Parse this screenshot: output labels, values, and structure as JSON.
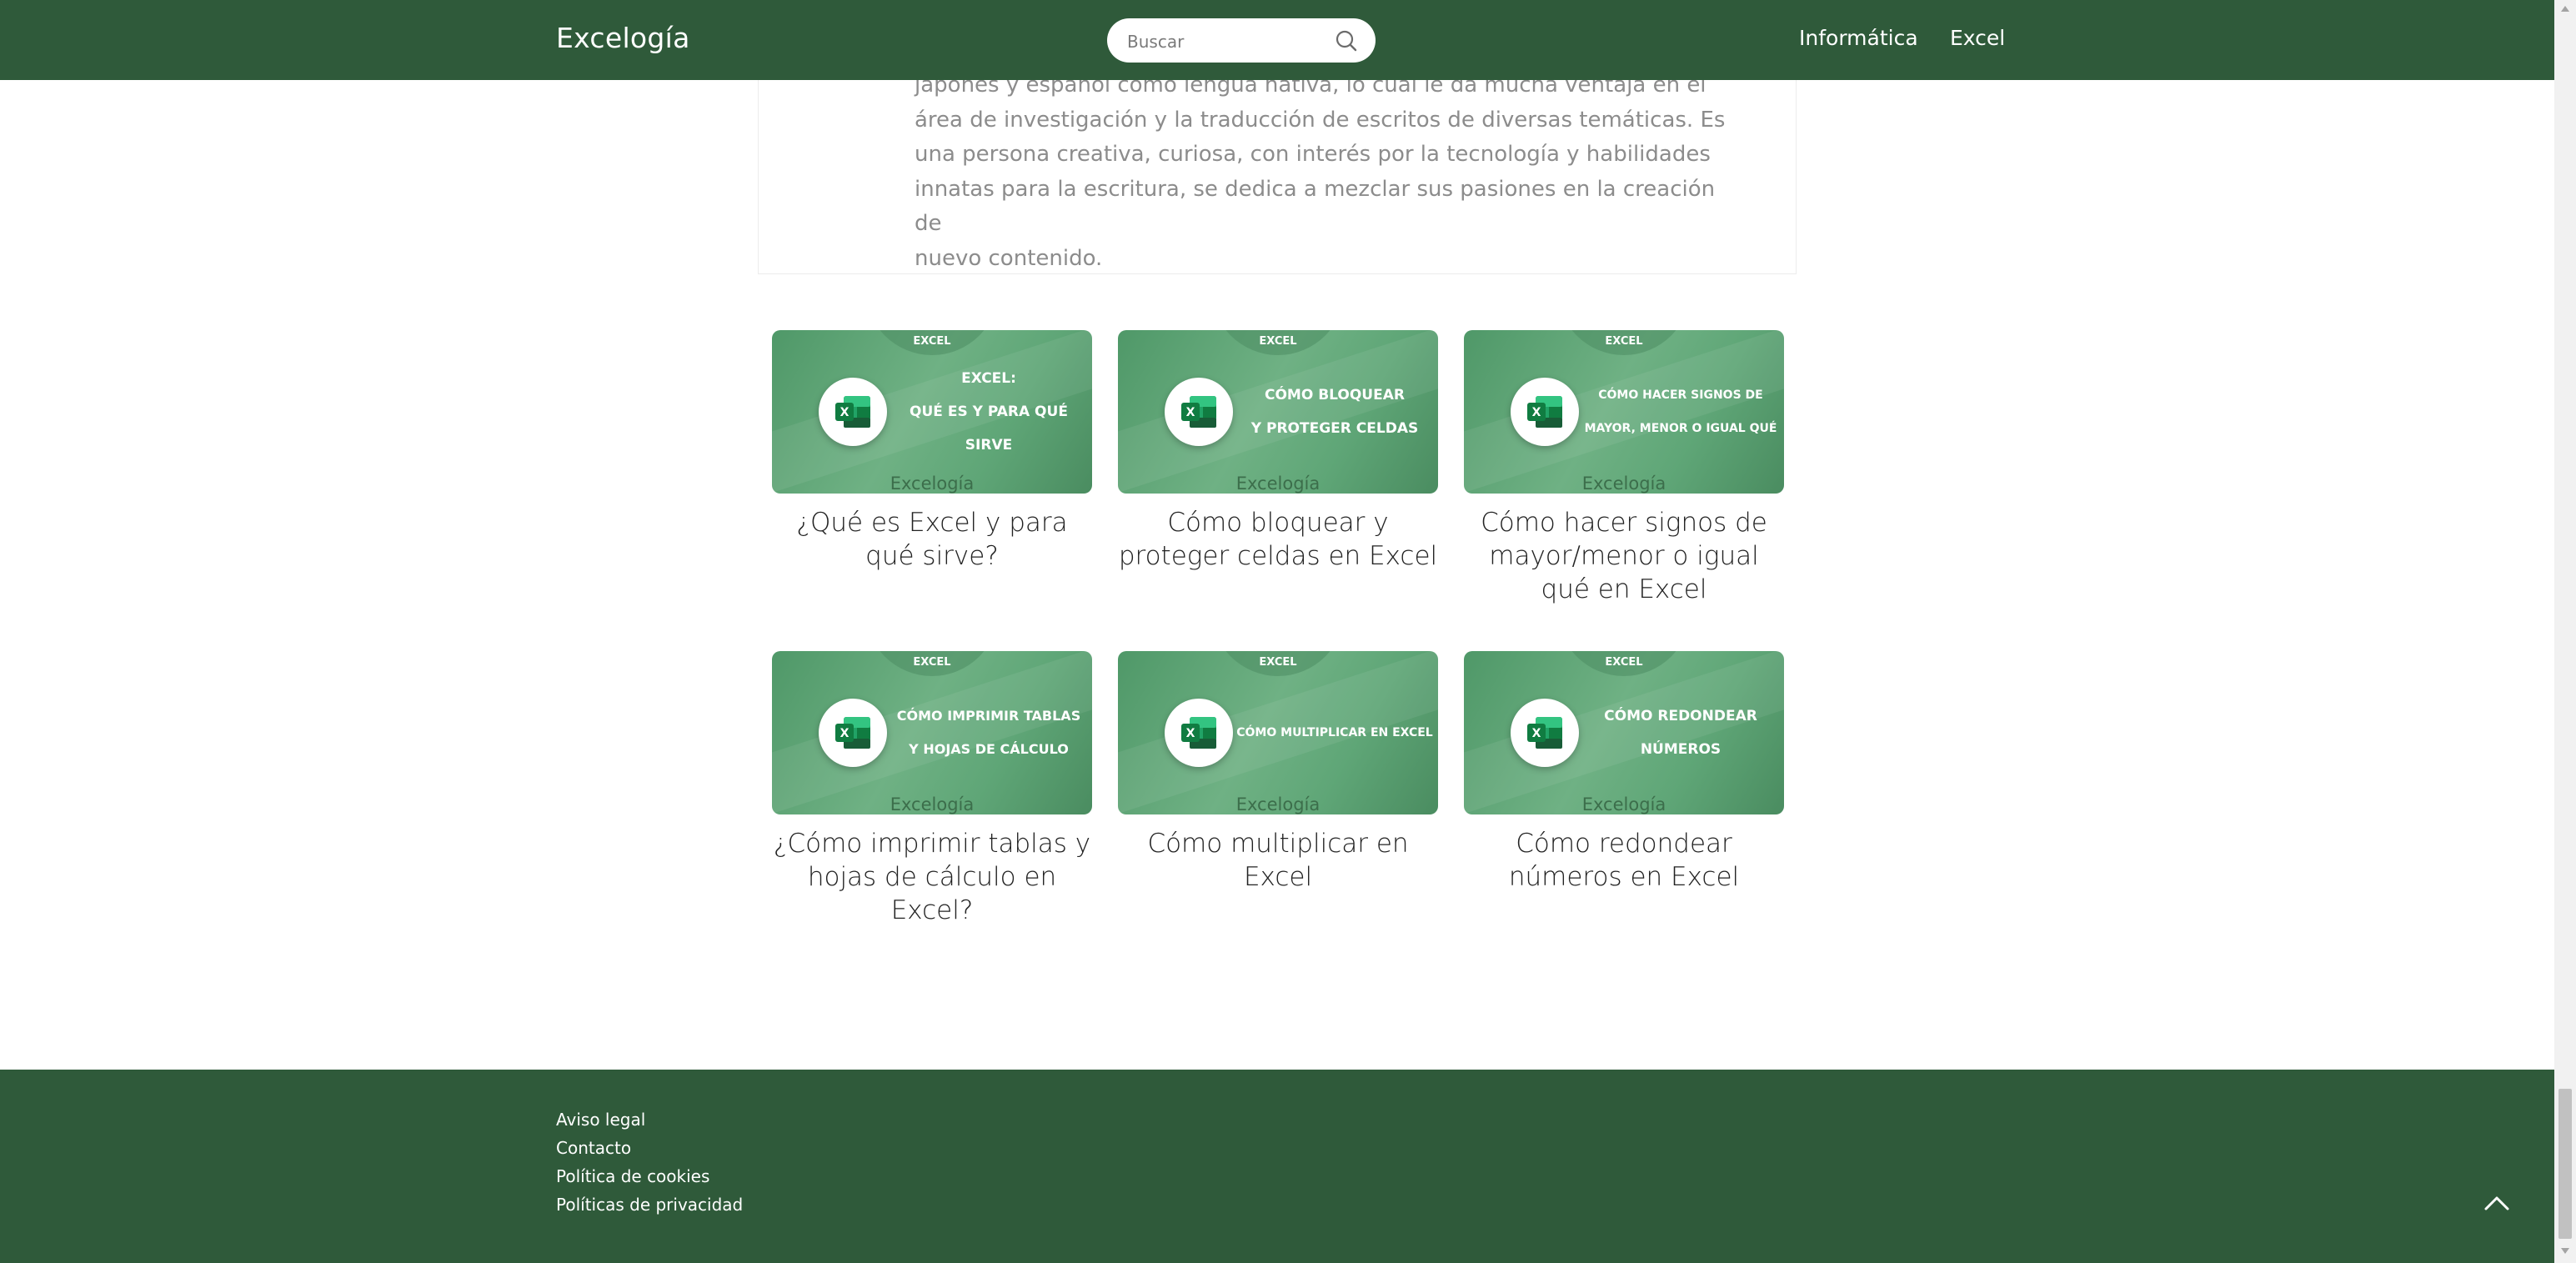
{
  "header": {
    "logo": "Excelogía",
    "search_placeholder": "Buscar",
    "nav": [
      "Informática",
      "Excel"
    ]
  },
  "author_bio": {
    "lines": [
      "japonés y español como lengua nativa, lo cual le da mucha ventaja en el",
      "área de investigación y la traducción de escritos de diversas temáticas. Es",
      "una persona creativa, curiosa, con interés por la tecnología y habilidades",
      "innatas para la escritura, se dedica a mezclar sus pasiones en la creación de",
      "nuevo contenido."
    ]
  },
  "related_posts": [
    {
      "thumb_category": "EXCEL",
      "thumb_title": "EXCEL:\nQUÉ ES Y PARA QUÉ SIRVE",
      "thumb_brand": "Excelogía",
      "title": "¿Qué es Excel y para qué sirve?"
    },
    {
      "thumb_category": "EXCEL",
      "thumb_title": "CÓMO BLOQUEAR\nY PROTEGER CELDAS",
      "thumb_brand": "Excelogía",
      "title": "Cómo bloquear y proteger celdas en Excel"
    },
    {
      "thumb_category": "EXCEL",
      "thumb_title": "CÓMO HACER SIGNOS DE\nMAYOR, MENOR O IGUAL QUÉ",
      "thumb_brand": "Excelogía",
      "title": "Cómo hacer signos de mayor/menor o igual qué en Excel"
    },
    {
      "thumb_category": "EXCEL",
      "thumb_title": "CÓMO IMPRIMIR TABLAS\nY HOJAS DE CÁLCULO",
      "thumb_brand": "Excelogía",
      "title": "¿Cómo imprimir tablas y hojas de cálculo en Excel?"
    },
    {
      "thumb_category": "EXCEL",
      "thumb_title": "CÓMO MULTIPLICAR EN EXCEL",
      "thumb_brand": "Excelogía",
      "title": "Cómo multiplicar en Excel"
    },
    {
      "thumb_category": "EXCEL",
      "thumb_title": "CÓMO REDONDEAR\nNÚMEROS",
      "thumb_brand": "Excelogía",
      "title": "Cómo redondear números en Excel"
    }
  ],
  "footer": {
    "links": [
      "Aviso legal",
      "Contacto",
      "Política de cookies",
      "Políticas de privacidad"
    ]
  },
  "colors": {
    "brand_green": "#2f5a3a",
    "thumb_green": "#5fa677"
  }
}
